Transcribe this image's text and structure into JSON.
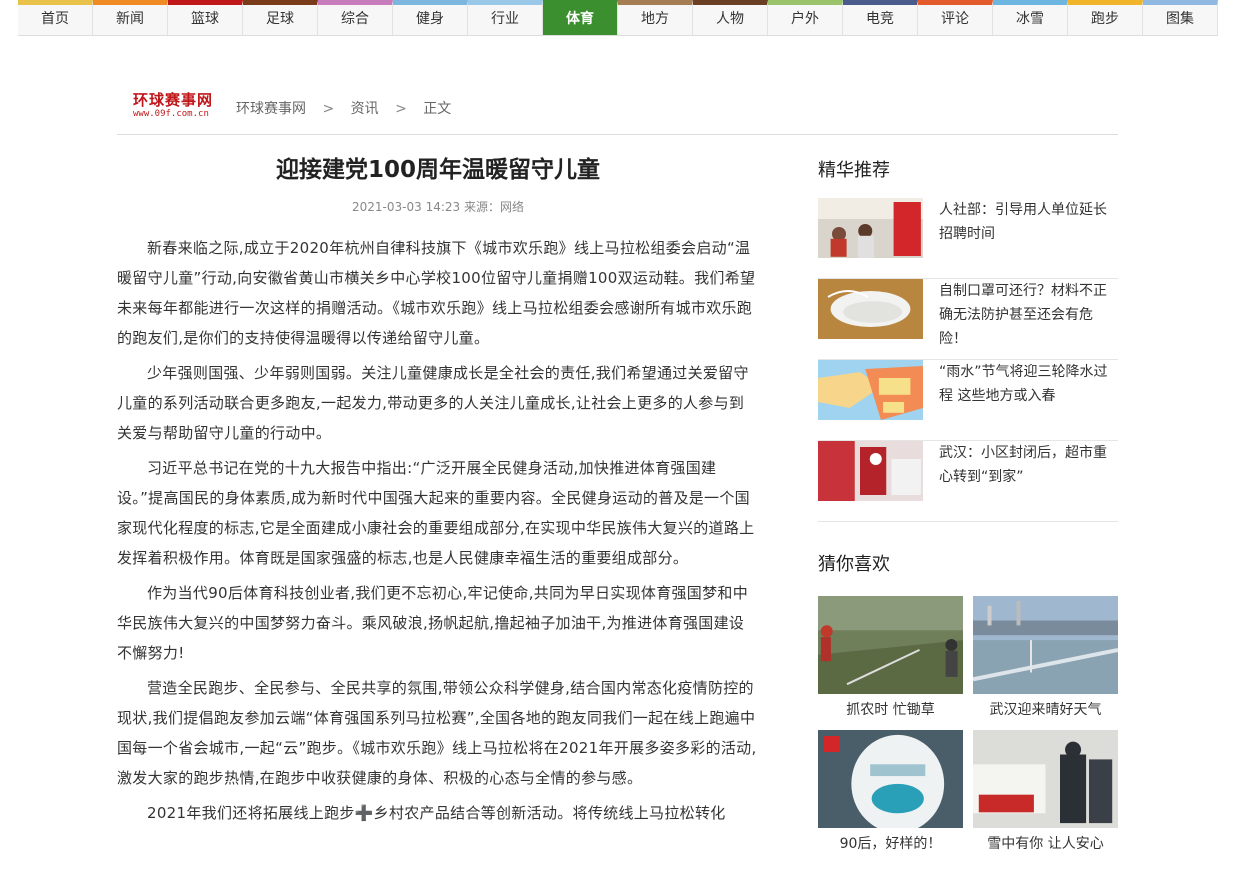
{
  "nav": [
    {
      "label": "首页",
      "color": "#e8c24a"
    },
    {
      "label": "新闻",
      "color": "#f08a24"
    },
    {
      "label": "篮球",
      "color": "#c0171a"
    },
    {
      "label": "足球",
      "color": "#7a3b1a"
    },
    {
      "label": "综合",
      "color": "#c77dbb"
    },
    {
      "label": "健身",
      "color": "#7db7e0"
    },
    {
      "label": "行业",
      "color": "#9ac8e8"
    },
    {
      "label": "体育",
      "color": "#3b8f2e",
      "active": true
    },
    {
      "label": "地方",
      "color": "#a67c52"
    },
    {
      "label": "人物",
      "color": "#6b3e26"
    },
    {
      "label": "户外",
      "color": "#9ac36b"
    },
    {
      "label": "电竞",
      "color": "#4a5a8a"
    },
    {
      "label": "评论",
      "color": "#e35a2c"
    },
    {
      "label": "冰雪",
      "color": "#6cb6e0"
    },
    {
      "label": "跑步",
      "color": "#f0b52a"
    },
    {
      "label": "图集",
      "color": "#8fb9e0"
    }
  ],
  "logo": {
    "line1": "环球赛事网",
    "line2": "www.09f.com.cn"
  },
  "breadcrumb": {
    "home": "环球赛事网",
    "sep": ">",
    "section": "资讯",
    "current": "正文"
  },
  "article": {
    "title": "迎接建党100周年温暖留守儿童",
    "meta": "2021-03-03 14:23 来源：网络",
    "paragraphs": [
      "新春来临之际,成立于2020年杭州自律科技旗下《城市欢乐跑》线上马拉松组委会启动“温暖留守儿童”行动,向安徽省黄山市横关乡中心学校100位留守儿童捐赠100双运动鞋。我们希望未来每年都能进行一次这样的捐赠活动。《城市欢乐跑》线上马拉松组委会感谢所有城市欢乐跑的跑友们,是你们的支持使得温暖得以传递给留守儿童。",
      "少年强则国强、少年弱则国弱。关注儿童健康成长是全社会的责任,我们希望通过关爱留守儿童的系列活动联合更多跑友,一起发力,带动更多的人关注儿童成长,让社会上更多的人参与到关爱与帮助留守儿童的行动中。",
      "习近平总书记在党的十九大报告中指出:“广泛开展全民健身活动,加快推进体育强国建设。”提高国民的身体素质,成为新时代中国强大起来的重要内容。全民健身运动的普及是一个国家现代化程度的标志,它是全面建成小康社会的重要组成部分,在实现中华民族伟大复兴的道路上发挥着积极作用。体育既是国家强盛的标志,也是人民健康幸福生活的重要组成部分。",
      "作为当代90后体育科技创业者,我们更不忘初心,牢记使命,共同为早日实现体育强国梦和中华民族伟大复兴的中国梦努力奋斗。乘风破浪,扬帆起航,撸起袖子加油干,为推进体育强国建设不懈努力!",
      "营造全民跑步、全民参与、全民共享的氛围,带领公众科学健身,结合国内常态化疫情防控的现状,我们提倡跑友参加云端“体育强国系列马拉松赛”,全国各地的跑友同我们一起在线上跑遍中国每一个省会城市,一起“云”跑步。《城市欢乐跑》线上马拉松将在2021年开展多姿多彩的活动,激发大家的跑步热情,在跑步中收获健康的身体、积极的心态与全情的参与感。",
      "2021年我们还将拓展线上跑步➕乡村农产品结合等创新活动。将传统线上马拉松转化"
    ]
  },
  "sidebar": {
    "rec_title": "精华推荐",
    "rec": [
      {
        "text": "人社部：引导用人单位延长招聘时间",
        "thumb": "office-photo"
      },
      {
        "text": "自制口罩可还行？材料不正确无法防护甚至还会有危险！",
        "thumb": "mask-photo"
      },
      {
        "text": "“雨水”节气将迎三轮降水过程 这些地方或入春",
        "thumb": "weather-map"
      },
      {
        "text": "武汉：小区封闭后，超市重心转到“到家”",
        "thumb": "supermarket-photo"
      }
    ],
    "like_title": "猜你喜欢",
    "like": [
      {
        "cap": "抓农时 忙锄草",
        "pic": "field-photo"
      },
      {
        "cap": "武汉迎来晴好天气",
        "pic": "bridge-photo"
      },
      {
        "cap": "90后，好样的！",
        "pic": "medic-photo"
      },
      {
        "cap": "雪中有你 让人安心",
        "pic": "snow-guard-photo"
      }
    ]
  }
}
